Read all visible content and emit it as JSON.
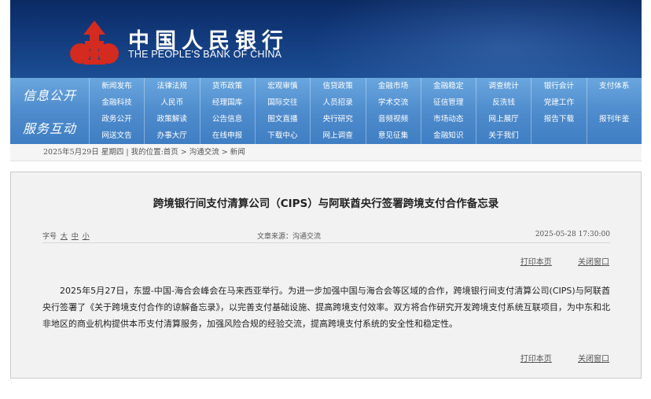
{
  "header": {
    "logo_cn": "中国人民银行",
    "logo_en": "THE PEOPLE'S BANK OF CHINA"
  },
  "nav": {
    "block1_title": "信息公开",
    "block2_title": "服务互动",
    "block1_rows": [
      [
        "新闻发布",
        "法律法规",
        "货币政策",
        "宏观审慎",
        "信贷政策",
        "金融市场",
        "金融稳定",
        "调查统计",
        "银行会计",
        "支付体系"
      ],
      [
        "金融科技",
        "人民币",
        "经理国库",
        "国际交往",
        "人员招录",
        "学术交流",
        "征信管理",
        "反洗钱",
        "党建工作",
        ""
      ]
    ],
    "block2_rows": [
      [
        "政务公开",
        "政策解读",
        "公告信息",
        "图文直播",
        "央行研究",
        "音频视频",
        "市场动态",
        "网上展厅",
        "报告下载",
        "报刊年鉴"
      ],
      [
        "网送文告",
        "办事大厅",
        "在线申报",
        "下载中心",
        "网上调查",
        "意见征集",
        "金融知识",
        "关于我们",
        "",
        ""
      ]
    ]
  },
  "breadcrumb": "2025年5月29日 星期四 | 我的位置:首页 > 沟通交流 > 新闻",
  "article": {
    "title": "跨境银行间支付清算公司（CIPS）与阿联酋央行签署跨境支付合作备忘录",
    "font_label": "字号",
    "font_large": "大",
    "font_medium": "中",
    "font_small": "小",
    "source": "文章来源：沟通交流",
    "date": "2025-05-28 17:30:00",
    "print_label": "打印本页",
    "close_label": "关闭窗口",
    "body": "2025年5月27日，东盟-中国-海合会峰会在马来西亚举行。为进一步加强中国与海合会等区域的合作，跨境银行间支付清算公司(CIPS)与阿联酋央行签署了《关于跨境支付合作的谅解备忘录》，以完善支付基础设施、提高跨境支付效率。双方将合作研究开发跨境支付系统互联项目，为中东和北非地区的商业机构提供本币支付清算服务，加强风险合规的经验交流，提高跨境支付系统的安全性和稳定性。"
  }
}
